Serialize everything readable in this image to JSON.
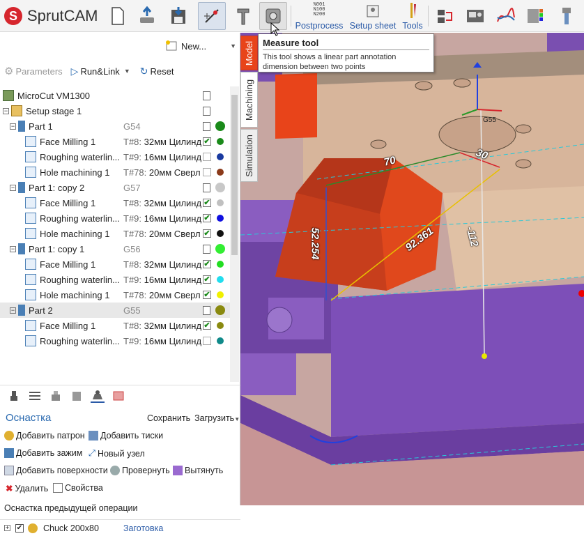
{
  "app": {
    "name": "SprutCAM",
    "logo_letter": "S"
  },
  "toolbar": {
    "buttons": [
      {
        "name": "new-document-button",
        "icon": "document-icon"
      },
      {
        "name": "import-button",
        "icon": "import-icon"
      },
      {
        "name": "save-button",
        "icon": "save-icon"
      },
      {
        "name": "snap-button",
        "icon": "snap-icon"
      },
      {
        "name": "caliper-button",
        "icon": "caliper-icon"
      },
      {
        "name": "measure-button",
        "icon": "measure-icon"
      }
    ],
    "postprocess": {
      "label": "Postprocess",
      "icon_text": "%001\nN100\nN200"
    },
    "setup_sheet": {
      "label": "Setup sheet"
    },
    "tools": {
      "label": "Tools"
    }
  },
  "left": {
    "new_label": "New...",
    "parameters_label": "Parameters",
    "runlink_label": "Run&Link",
    "reset_label": "Reset",
    "tree": [
      {
        "type": "machine",
        "label": "MicroCut VM1300",
        "doc": true
      },
      {
        "type": "stage",
        "label": "Setup stage 1",
        "doc": true
      },
      {
        "type": "part",
        "label": "Part 1",
        "g": "G54",
        "dot": "#1a8a1a",
        "big": true
      },
      {
        "type": "op",
        "label": "Face Milling 1",
        "tool_no": "T#8:",
        "tool": "32мм Цилинд",
        "check": true,
        "dot": "#1a8a1a"
      },
      {
        "type": "op",
        "label": "Roughing waterlin...",
        "tool_no": "T#9:",
        "tool": "16мм Цилинд",
        "check": false,
        "dot": "#1a3aa0"
      },
      {
        "type": "op",
        "label": "Hole machining 1",
        "tool_no": "T#78:",
        "tool": "20мм Сверл",
        "check": false,
        "dot": "#8b3a1a"
      },
      {
        "type": "part",
        "label": "Part 1: copy 2",
        "g": "G57",
        "dot": "#c8c8c8",
        "big": true
      },
      {
        "type": "op",
        "label": "Face Milling 1",
        "tool_no": "T#8:",
        "tool": "32мм Цилинд",
        "check": true,
        "dot": "#c0c0c0"
      },
      {
        "type": "op",
        "label": "Roughing waterlin...",
        "tool_no": "T#9:",
        "tool": "16мм Цилинд",
        "check": true,
        "dot": "#1010e0"
      },
      {
        "type": "op",
        "label": "Hole machining 1",
        "tool_no": "T#78:",
        "tool": "20мм Сверл",
        "check": true,
        "dot": "#111111"
      },
      {
        "type": "part",
        "label": "Part 1: copy 1",
        "g": "G56",
        "dot": "#33ee33",
        "big": true
      },
      {
        "type": "op",
        "label": "Face Milling 1",
        "tool_no": "T#8:",
        "tool": "32мм Цилинд",
        "check": true,
        "dot": "#22dd22"
      },
      {
        "type": "op",
        "label": "Roughing waterlin...",
        "tool_no": "T#9:",
        "tool": "16мм Цилинд",
        "check": true,
        "dot": "#22ddee"
      },
      {
        "type": "op",
        "label": "Hole machining 1",
        "tool_no": "T#78:",
        "tool": "20мм Сверл",
        "check": true,
        "dot": "#f0f000"
      },
      {
        "type": "part",
        "label": "Part 2",
        "g": "G55",
        "dot": "#8a8a10",
        "big": true,
        "selected": true
      },
      {
        "type": "op",
        "label": "Face Milling 1",
        "tool_no": "T#8:",
        "tool": "32мм Цилинд",
        "check": true,
        "dot": "#8a8a10"
      },
      {
        "type": "op",
        "label": "Roughing waterlin...",
        "tool_no": "T#9:",
        "tool": "16мм Цилинд",
        "check": false,
        "dot": "#108a8a"
      }
    ],
    "osnastka": {
      "title": "Оснастка",
      "save": "Сохранить",
      "load": "Загрузить",
      "actions": [
        {
          "label": "Добавить патрон"
        },
        {
          "label": "Добавить тиски"
        },
        {
          "label": "Добавить зажим"
        },
        {
          "label": "Новый узел"
        },
        {
          "label": "Добавить поверхности"
        },
        {
          "label": "Провернуть"
        },
        {
          "label": "Вытянуть"
        },
        {
          "label": "Удалить"
        },
        {
          "label": "Свойства"
        }
      ],
      "prev_op": "Оснастка предыдущей операции",
      "chuck": "Chuck 200x80",
      "chuck_ref": "Заготовка"
    }
  },
  "vtabs": {
    "model": "Model",
    "machining": "Machining",
    "simulation": "Simulation"
  },
  "viewport": {
    "dims": [
      "70",
      "30",
      "52.254",
      "92.361",
      "-112"
    ],
    "csys": "G55"
  },
  "tooltip": {
    "title": "Measure tool",
    "body": "This tool shows a linear part annotation dimension between two points"
  }
}
